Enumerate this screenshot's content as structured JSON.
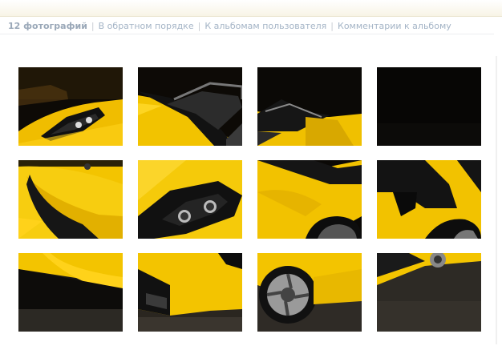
{
  "toolbar": {
    "photo_count": "12 фотографий",
    "reverse_order": "В обратном порядке",
    "to_user_albums": "К альбомам пользователя",
    "album_comments": "Комментарии к альбому",
    "separator": "|"
  },
  "gallery": {
    "photo_total": 12,
    "columns": 4,
    "rows": 3,
    "photos": [
      {
        "icon": "car-photo-thumbnail"
      },
      {
        "icon": "car-photo-thumbnail"
      },
      {
        "icon": "car-photo-thumbnail"
      },
      {
        "icon": "car-photo-thumbnail"
      },
      {
        "icon": "car-photo-thumbnail"
      },
      {
        "icon": "car-photo-thumbnail"
      },
      {
        "icon": "car-photo-thumbnail"
      },
      {
        "icon": "car-photo-thumbnail"
      },
      {
        "icon": "car-photo-thumbnail"
      },
      {
        "icon": "car-photo-thumbnail"
      },
      {
        "icon": "car-photo-thumbnail"
      },
      {
        "icon": "car-photo-thumbnail"
      }
    ]
  },
  "colors": {
    "car_yellow": "#f2c200",
    "background_dark": "#0b0906",
    "link_color": "#a4b4c6"
  }
}
